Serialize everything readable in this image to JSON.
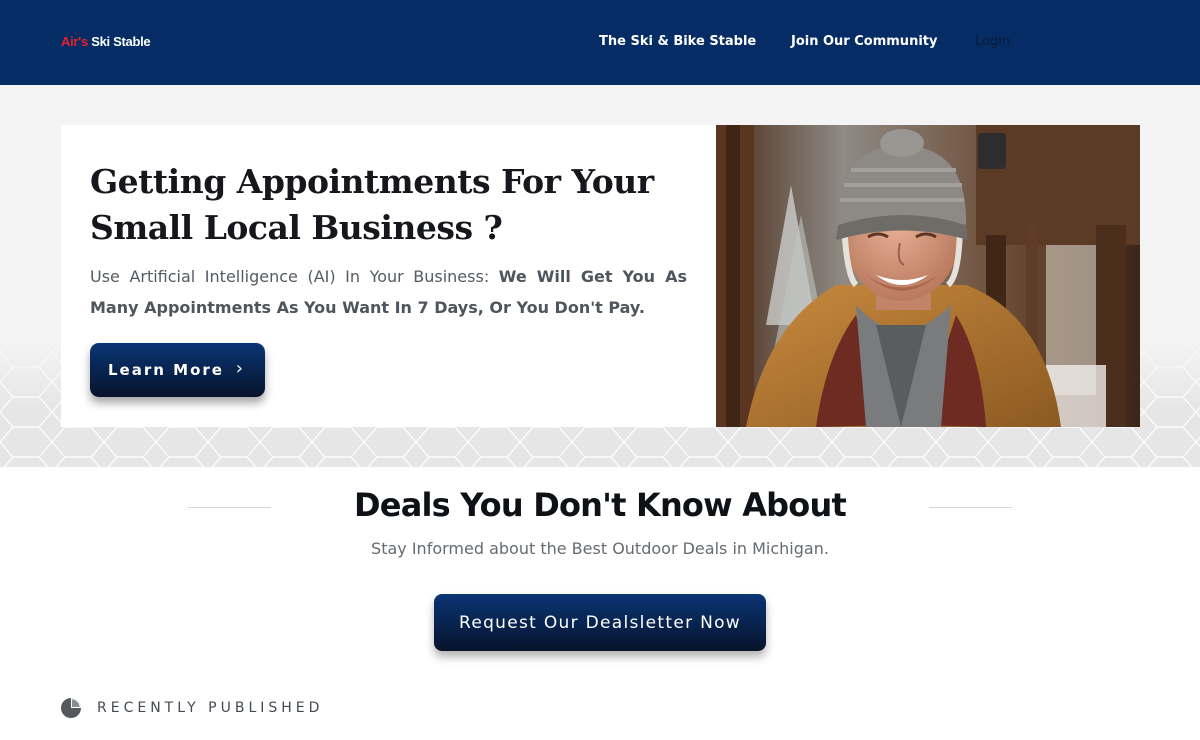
{
  "header": {
    "logo_part1": "Air's",
    "logo_part2": " Ski Stable",
    "nav": [
      "The Ski & Bike Stable",
      "Join Our Community",
      "Login"
    ],
    "background": "#052c65"
  },
  "hero": {
    "title": "Getting Appointments For Your Small Local Business ?",
    "text_plain": "Use Artificial Intelligence (AI) In Your Business: ",
    "text_bold": "We Will Get You As Many Appointments As You Want In 7 Days, Or You Don't Pay.",
    "button_label": "Learn More",
    "button_icon": "chevron-right-icon"
  },
  "deals": {
    "title": "Deals You Don't Know About",
    "subtitle": "Stay Informed about the Best Outdoor Deals in Michigan.",
    "button_label": "Request Our Dealsletter Now"
  },
  "recent": {
    "icon": "pie-chart-icon",
    "label": "RECENTLY PUBLISHED"
  },
  "colors": {
    "brand_navy": "#052c65",
    "logo_red": "#e8202a",
    "button_dark": "#07132b"
  }
}
